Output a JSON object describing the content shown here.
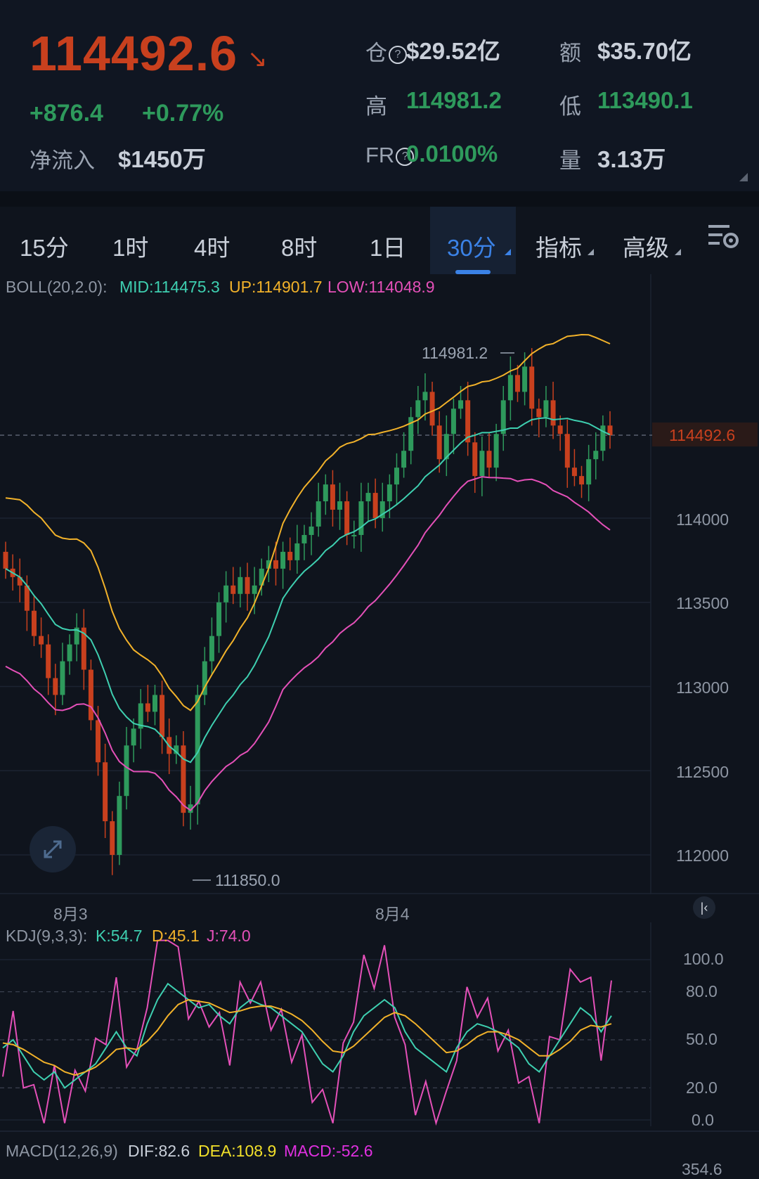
{
  "ticker": {
    "price": "114492.6",
    "change": "+876.4",
    "change_pct": "+0.77%",
    "net_inflow_label": "净流入",
    "net_inflow": "$1450万",
    "open_interest_label": "仓",
    "open_interest": "$29.52亿",
    "amount_label": "额",
    "amount": "$35.70亿",
    "high_label": "高",
    "high": "114981.2",
    "low_label": "低",
    "low": "113490.1",
    "fr_label": "FR",
    "funding_rate": "0.0100%",
    "volume_label": "量",
    "volume": "3.13万"
  },
  "tabs": [
    "15分",
    "1时",
    "4时",
    "8时",
    "1日",
    "30分",
    "指标",
    "高级"
  ],
  "active_tab": "30分",
  "boll": {
    "label": "BOLL(20,2.0):",
    "mid": "MID:114475.3",
    "up": "UP:114901.7",
    "low": "LOW:114048.9"
  },
  "price_axis": [
    "114000",
    "113500",
    "113000",
    "112500",
    "112000"
  ],
  "current_price_tag": "114492.6",
  "high_marker": "114981.2",
  "low_marker": "111850.0",
  "date_labels": [
    "8月3",
    "8月4"
  ],
  "kdj": {
    "label": "KDJ(9,3,3):",
    "k": "K:54.7",
    "d": "D:45.1",
    "j": "J:74.0",
    "axis": [
      "100.0",
      "80.0",
      "50.0",
      "20.0",
      "0.0"
    ]
  },
  "macd": {
    "label": "MACD(12,26,9)",
    "dif": "DIF:82.6",
    "dea": "DEA:108.9",
    "macd": "MACD:-52.6",
    "axis_top": "354.6"
  },
  "colors": {
    "up": "#2e9a5c",
    "down": "#c8401e",
    "mid": "#3ecfb0",
    "upper": "#f2b22a",
    "lower": "#e450b8",
    "active": "#3b82e6"
  }
}
